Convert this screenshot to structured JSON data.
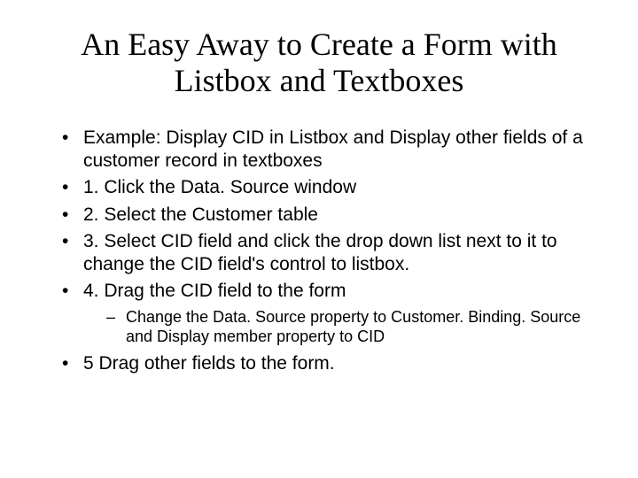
{
  "title": "An Easy Away to Create a Form with Listbox and Textboxes",
  "bullets": {
    "b0": "Example: Display CID in Listbox and Display other fields of a customer record in textboxes",
    "b1": "1. Click the Data. Source window",
    "b2": "2. Select the Customer table",
    "b3": "3. Select CID field and click the drop down list next to it to change the CID field's control to listbox.",
    "b4": "4. Drag the CID field to the form",
    "b4_sub": "Change the Data. Source property to Customer. Binding. Source and Display member property to CID",
    "b5": "5 Drag other fields to the form."
  }
}
